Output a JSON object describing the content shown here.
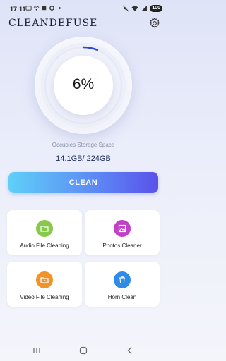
{
  "status_bar": {
    "time": "17:11",
    "battery": "100",
    "icons": [
      "message-icon",
      "wifi-small-icon",
      "location-icon",
      "settings-small-icon",
      "dot-icon",
      "mute-icon",
      "wifi-icon",
      "signal-icon"
    ]
  },
  "header": {
    "title": "CLEANDEFUSE",
    "settings_icon": "gear-icon"
  },
  "gauge": {
    "percent_text": "6%",
    "percent_value": 6,
    "colors": {
      "accent": "#2f47d8"
    }
  },
  "storage": {
    "label": "Occupies Storage Space",
    "values": "14.1GB/ 224GB"
  },
  "clean_button": {
    "label": "CLEAN",
    "colors": {
      "from": "#5fd0f8",
      "to": "#5a52ea"
    }
  },
  "features": [
    {
      "label": "Audio File Cleaning",
      "icon": "folder-icon",
      "color": "#88c84a"
    },
    {
      "label": "Photos Cleaner",
      "icon": "image-icon",
      "color": "#c23fc9"
    },
    {
      "label": "Video File Cleaning",
      "icon": "folder-icon",
      "color": "#f0942a"
    },
    {
      "label": "Horn Clean",
      "icon": "trash-icon",
      "color": "#2f8be8"
    }
  ],
  "nav": {
    "icons": [
      "recents-icon",
      "home-icon",
      "back-icon"
    ]
  }
}
